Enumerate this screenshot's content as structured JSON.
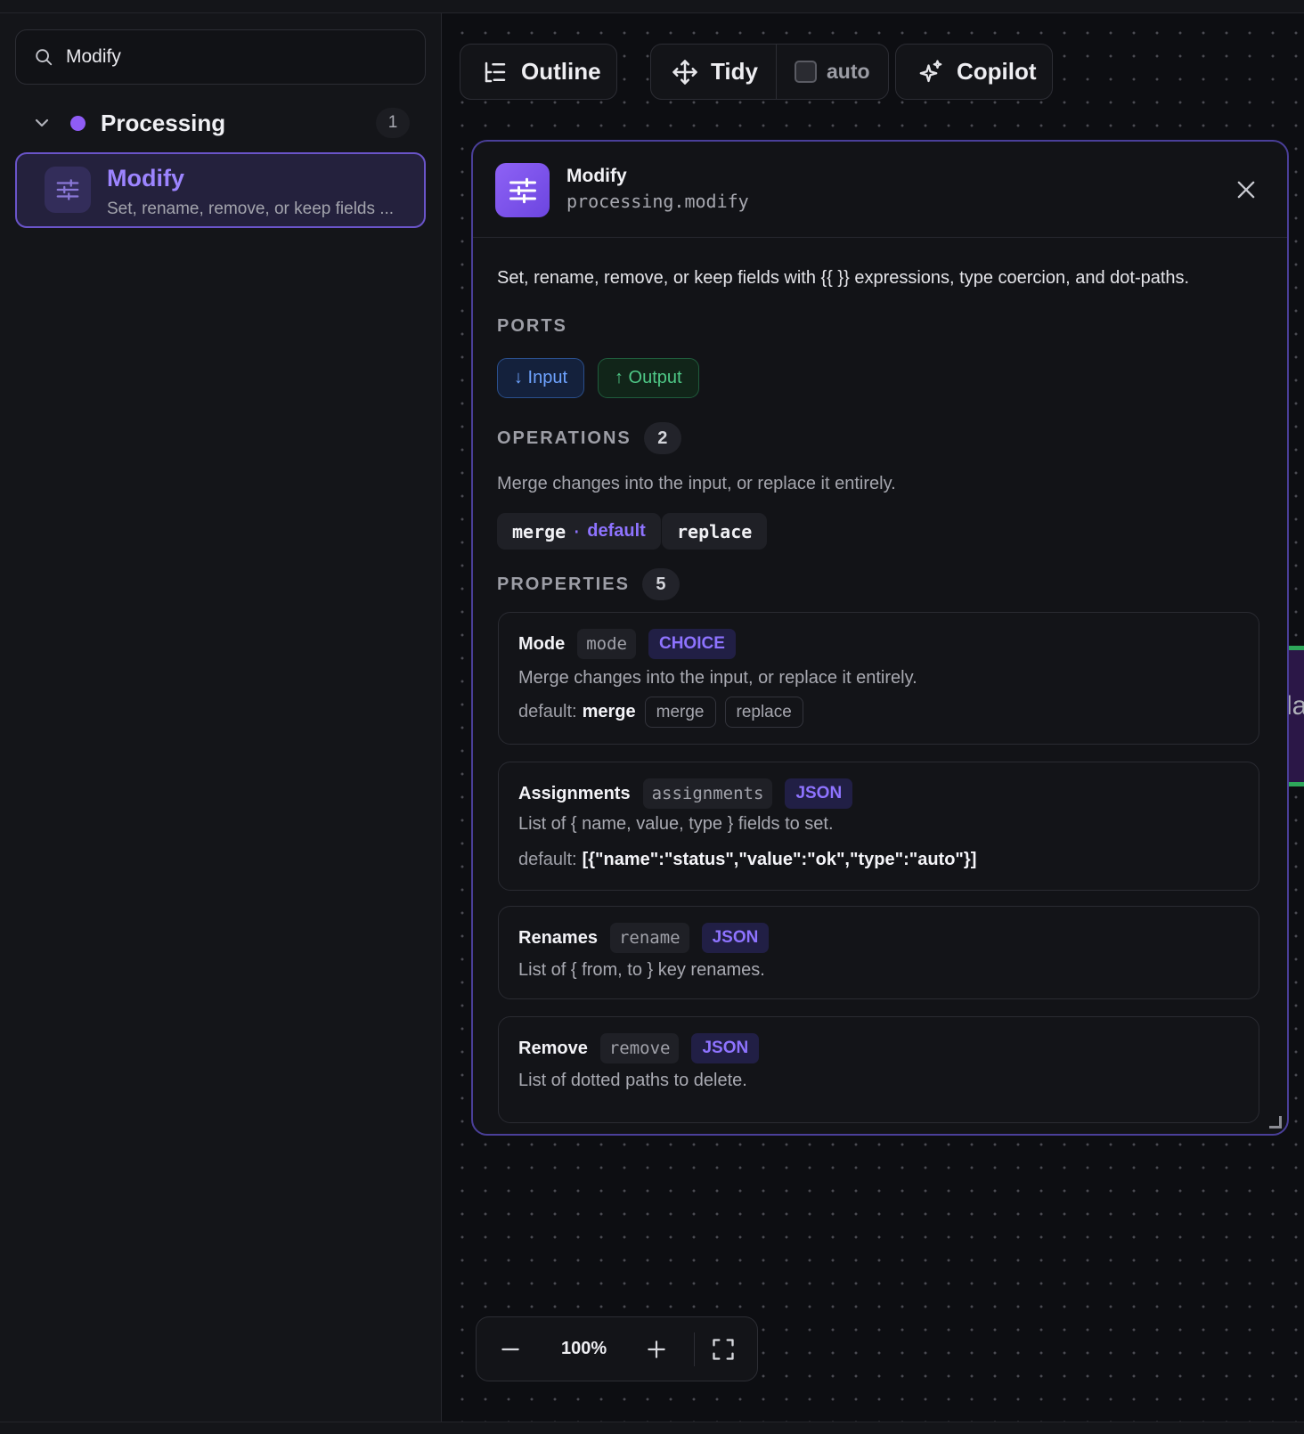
{
  "sidebar": {
    "search": {
      "value": "Modify"
    },
    "group": {
      "name": "Processing",
      "count": "1",
      "dot_color": "#8f5cf6"
    },
    "item": {
      "title": "Modify",
      "subtitle": "Set, rename, remove, or keep fields ..."
    }
  },
  "toolbar": {
    "outline_label": "Outline",
    "tidy_label": "Tidy",
    "auto_label": "auto",
    "copilot_label": "Copilot"
  },
  "canvas_peek": {
    "text": "la"
  },
  "panel": {
    "title": "Modify",
    "key": "processing.modify",
    "description": "Set, rename, remove, or keep fields with {{ }} expressions, type coercion, and dot-paths.",
    "ports": {
      "heading": "PORTS",
      "input_label": "↓ Input",
      "output_label": "↑ Output"
    },
    "operations": {
      "heading": "OPERATIONS",
      "count": "2",
      "description": "Merge changes into the input, or replace it entirely.",
      "items": [
        {
          "name": "merge",
          "sep": "·",
          "suffix": "default"
        },
        {
          "name": "replace"
        }
      ]
    },
    "properties": {
      "heading": "PROPERTIES",
      "count": "5",
      "items": [
        {
          "name": "Mode",
          "key": "mode",
          "type": "CHOICE",
          "description": "Merge changes into the input, or replace it entirely.",
          "default_label": "default:",
          "default_value": "merge",
          "options": [
            "merge",
            "replace"
          ]
        },
        {
          "name": "Assignments",
          "key": "assignments",
          "type": "JSON",
          "description": "List of { name, value, type } fields to set.",
          "default_label": "default:",
          "default_value": "[{\"name\":\"status\",\"value\":\"ok\",\"type\":\"auto\"}]"
        },
        {
          "name": "Renames",
          "key": "rename",
          "type": "JSON",
          "description": "List of { from, to } key renames."
        },
        {
          "name": "Remove",
          "key": "remove",
          "type": "JSON",
          "description": "List of dotted paths to delete."
        }
      ]
    }
  },
  "zoom": {
    "level": "100%"
  },
  "colors": {
    "accent": "#8e73ff",
    "panel_border": "#4a3f99",
    "input_port": "#6ea3ff",
    "output_port": "#4fc987"
  }
}
